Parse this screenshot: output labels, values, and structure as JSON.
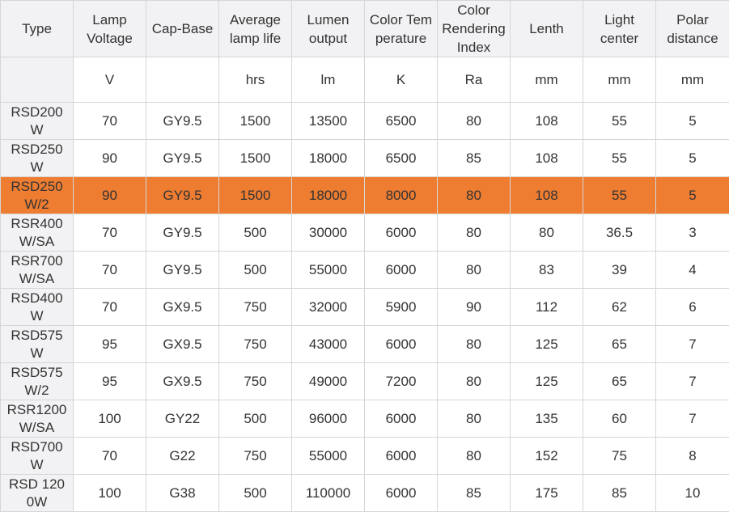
{
  "table": {
    "headers": [
      "Type",
      "Lamp Voltage",
      "Cap-Base",
      "Average lamp life",
      "Lumen output",
      "Color Temperature",
      "Color Rendering Index",
      "Lenth",
      "Light center",
      "Polar distance"
    ],
    "units": [
      "",
      "V",
      "",
      "hrs",
      "lm",
      "K",
      "Ra",
      "mm",
      "mm",
      "mm"
    ],
    "rows": [
      [
        "RSD200W",
        "70",
        "GY9.5",
        "1500",
        "13500",
        "6500",
        "80",
        "108",
        "55",
        "5"
      ],
      [
        "RSD250W",
        "90",
        "GY9.5",
        "1500",
        "18000",
        "6500",
        "85",
        "108",
        "55",
        "5"
      ],
      [
        "RSD250W/2",
        "90",
        "GY9.5",
        "1500",
        "18000",
        "8000",
        "80",
        "108",
        "55",
        "5"
      ],
      [
        "RSR400W/SA",
        "70",
        "GY9.5",
        "500",
        "30000",
        "6000",
        "80",
        "80",
        "36.5",
        "3"
      ],
      [
        "RSR700W/SA",
        "70",
        "GY9.5",
        "500",
        "55000",
        "6000",
        "80",
        "83",
        "39",
        "4"
      ],
      [
        "RSD400W",
        "70",
        "GX9.5",
        "750",
        "32000",
        "5900",
        "90",
        "112",
        "62",
        "6"
      ],
      [
        "RSD575W",
        "95",
        "GX9.5",
        "750",
        "43000",
        "6000",
        "80",
        "125",
        "65",
        "7"
      ],
      [
        "RSD575W/2",
        "95",
        "GX9.5",
        "750",
        "49000",
        "7200",
        "80",
        "125",
        "65",
        "7"
      ],
      [
        "RSR1200W/SA",
        "100",
        "GY22",
        "500",
        "96000",
        "6000",
        "80",
        "135",
        "60",
        "7"
      ],
      [
        "RSD700W",
        "70",
        "G22",
        "750",
        "55000",
        "6000",
        "80",
        "152",
        "75",
        "8"
      ],
      [
        "RSD 1200W",
        "100",
        "G38",
        "500",
        "110000",
        "6000",
        "85",
        "175",
        "85",
        "10"
      ]
    ],
    "highlight_row_index": 2,
    "highlight_color": "#ee7d31",
    "header_bg": "#f2f2f4",
    "border_color": "#d6d6d6"
  }
}
